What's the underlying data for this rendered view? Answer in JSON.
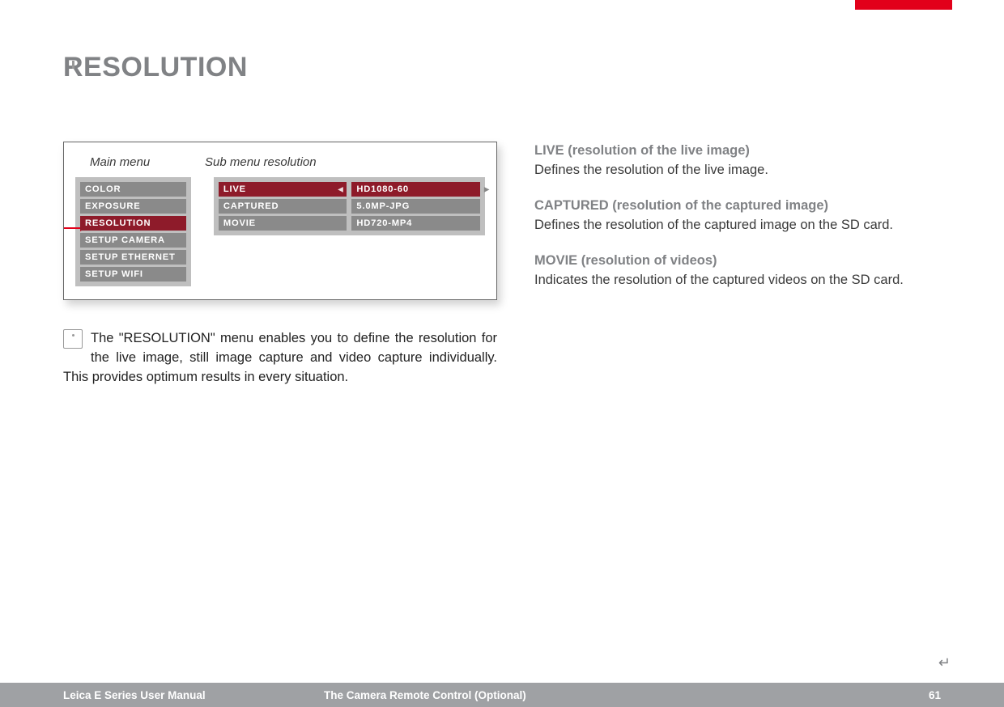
{
  "page_title": "RESOLUTION",
  "menu_labels": {
    "main": "Main menu",
    "sub": "Sub menu resolution"
  },
  "main_menu": {
    "items": [
      {
        "label": "COLOR",
        "selected": false
      },
      {
        "label": "EXPOSURE",
        "selected": false
      },
      {
        "label": "RESOLUTION",
        "selected": true
      },
      {
        "label": "SETUP CAMERA",
        "selected": false
      },
      {
        "label": "SETUP ETHERNET",
        "selected": false
      },
      {
        "label": "SETUP WIFI",
        "selected": false
      }
    ]
  },
  "sub_menu": {
    "left": [
      {
        "label": "LIVE",
        "selected": true
      },
      {
        "label": "CAPTURED",
        "selected": false
      },
      {
        "label": "MOVIE",
        "selected": false
      }
    ],
    "right": [
      {
        "label": "HD1080-60",
        "selected": true
      },
      {
        "label": "5.0MP-JPG",
        "selected": false
      },
      {
        "label": "HD720-MP4",
        "selected": false
      }
    ]
  },
  "info_text": "The \"RESOLUTION\" menu enables you to define the resolution for the live image, still image capture and video capture individually. This provides optimum results in every situation.",
  "sections": [
    {
      "head": "LIVE (resolution of the live image)",
      "body": "Defines the resolution of the live image."
    },
    {
      "head": "CAPTURED (resolution of the captured image)",
      "body": "Defines the resolution of the captured image on the SD card."
    },
    {
      "head": "MOVIE (resolution of videos)",
      "body": "Indicates the resolution of the captured videos on the SD card."
    }
  ],
  "footer": {
    "left": "Leica E Series User Manual",
    "center": "The Camera Remote Control (Optional)",
    "page": "61"
  }
}
